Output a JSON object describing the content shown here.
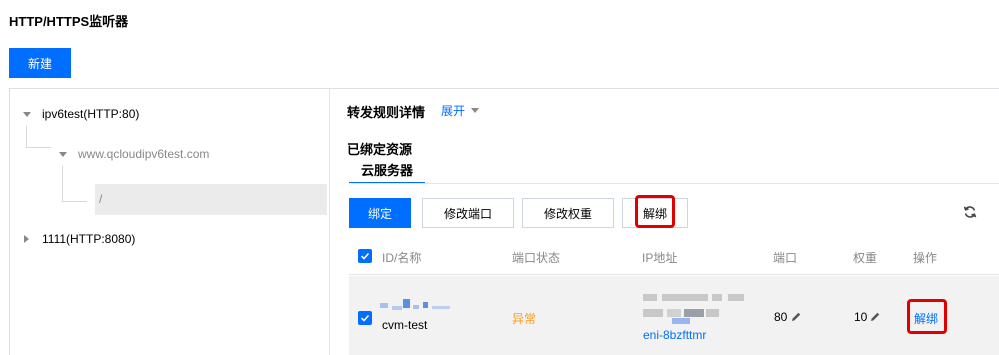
{
  "page": {
    "title": "HTTP/HTTPS监听器"
  },
  "toolbar": {
    "new_label": "新建"
  },
  "tree": {
    "nodes": [
      {
        "label": "ipv6test(HTTP:80)"
      },
      {
        "label": "www.qcloudipv6test.com"
      },
      {
        "label": "/"
      },
      {
        "label": "1111(HTTP:8080)"
      }
    ]
  },
  "rule": {
    "title": "转发规则详情",
    "expand_label": "展开"
  },
  "bound": {
    "title": "已绑定资源",
    "tab_label": "云服务器",
    "buttons": {
      "bind": "绑定",
      "modify_port": "修改端口",
      "modify_weight": "修改权重",
      "unbind": "解绑"
    }
  },
  "table": {
    "columns": [
      "ID/名称",
      "端口状态",
      "IP地址",
      "端口",
      "权重",
      "操作"
    ],
    "rows": [
      {
        "name": "cvm-test",
        "port_status": "异常",
        "eni": "eni-8bzfttmr",
        "port": "80",
        "weight": "10",
        "action": "解绑"
      }
    ]
  },
  "colors": {
    "accent": "#006eff",
    "warning": "#ff9c19",
    "highlight": "#e00000"
  },
  "icons": [
    "caret-down-icon",
    "caret-right-icon",
    "refresh-icon",
    "edit-icon",
    "check-icon"
  ]
}
